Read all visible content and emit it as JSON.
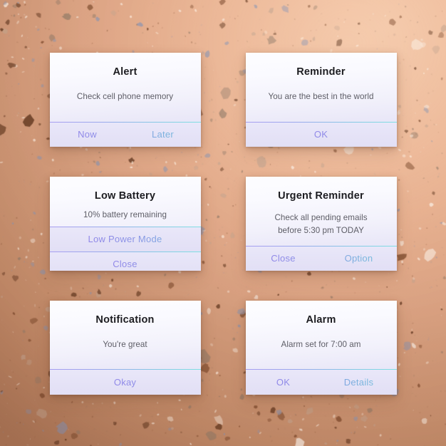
{
  "background": {
    "name": "terrazzo-speckle-texture",
    "base_color": "#e0a482",
    "light_color": "#f2c3a3",
    "dark_color": "#b9805f",
    "speckle_colors": [
      "#6b4027",
      "#8a5638",
      "#a0826d",
      "#9a97a8",
      "#f6e4d6",
      "#c9a48c"
    ]
  },
  "theme": {
    "card_top_color": "#fdfdff",
    "card_bottom_color": "#dedbf3",
    "action_bg_top": "#e9e7f9",
    "action_bg_bottom": "#e2dff5",
    "gradient_start": "#8f86e8",
    "gradient_end": "#6fd4d8",
    "title_color": "#1c1c20",
    "message_color": "#5d5d66"
  },
  "cards": [
    {
      "id": "alert",
      "title": "Alert",
      "message": "Check cell phone memory",
      "message_lines": [
        "Check cell phone memory"
      ],
      "layout": "two-buttons",
      "buttons": [
        {
          "label": "Now"
        },
        {
          "label": "Later"
        }
      ]
    },
    {
      "id": "reminder",
      "title": "Reminder",
      "message": "You are the best in the world",
      "message_lines": [
        "You are the best in the world"
      ],
      "layout": "one-button",
      "buttons": [
        {
          "label": "OK"
        }
      ]
    },
    {
      "id": "low-battery",
      "title": "Low Battery",
      "message": "10% battery remaining",
      "message_lines": [
        "10% battery remaining"
      ],
      "layout": "stacked-two-buttons",
      "buttons": [
        {
          "label": "Low Power Mode"
        },
        {
          "label": "Close"
        }
      ]
    },
    {
      "id": "urgent-reminder",
      "title": "Urgent Reminder",
      "message": "Check all pending emails before 5:30 pm TODAY",
      "message_lines": [
        "Check all pending emails",
        "before 5:30 pm TODAY"
      ],
      "layout": "two-buttons",
      "buttons": [
        {
          "label": "Close"
        },
        {
          "label": "Option"
        }
      ]
    },
    {
      "id": "notification",
      "title": "Notification",
      "message": "You're great",
      "message_lines": [
        "You're great"
      ],
      "layout": "one-button",
      "buttons": [
        {
          "label": "Okay"
        }
      ]
    },
    {
      "id": "alarm",
      "title": "Alarm",
      "message": "Alarm set for 7:00 am",
      "message_lines": [
        "Alarm set for 7:00 am"
      ],
      "layout": "two-buttons",
      "buttons": [
        {
          "label": "OK"
        },
        {
          "label": "Details"
        }
      ]
    }
  ]
}
